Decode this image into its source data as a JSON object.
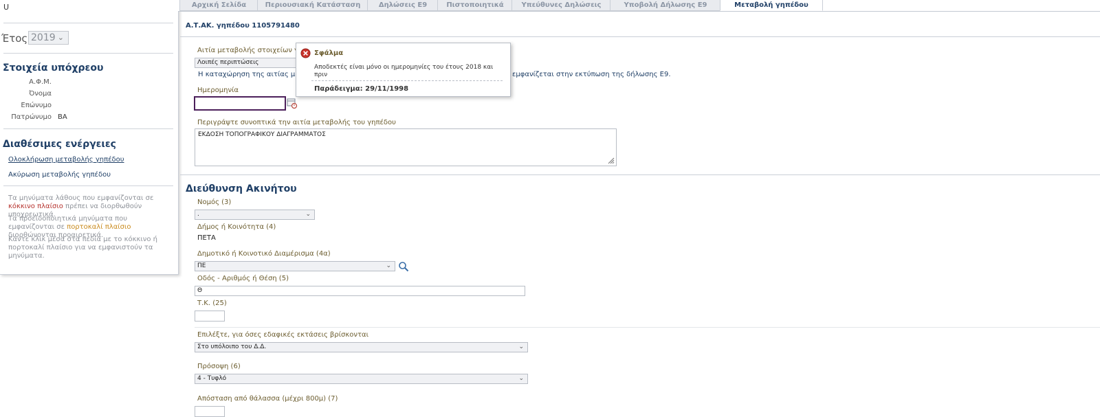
{
  "sidebar": {
    "top_text": "U",
    "year_label": "Έτος",
    "year_value": "2019",
    "taxpayer_heading": "Στοιχεία υπόχρεου",
    "fields": [
      {
        "label": "Α.Φ.Μ.",
        "value": ""
      },
      {
        "label": "Όνομα",
        "value": ""
      },
      {
        "label": "Επώνυμο",
        "value": ""
      },
      {
        "label": "Πατρώνυμο",
        "value": "ΒΑ"
      }
    ],
    "actions_heading": "Διαθέσιμες ενέργειες",
    "actions": [
      "Ολοκλήρωση μεταβολής γηπέδου",
      "Ακύρωση μεταβολής γηπέδου"
    ],
    "help": {
      "p1_a": "Τα μηνύματα λάθους που εμφανίζονται σε ",
      "p1_red": "κόκκινο πλαίσιο",
      "p1_b": " πρέπει να διορθωθούν υποχρεωτικά.",
      "p2_a": "Τα προειδοποιητικά μηνύματα που εμφανίζονται σε ",
      "p2_orange": "πορτοκαλί πλαίσιο",
      "p2_b": " διορθώνονται προαιρετικά.",
      "p3": "Κάντε κλικ μέσα στα πεδία με το κόκκινο ή πορτοκαλί πλαίσιο για να εμφανιστούν τα μηνύματα."
    }
  },
  "tabs": [
    {
      "label": "Αρχική Σελίδα",
      "active": false
    },
    {
      "label": "Περιουσιακή Κατάσταση",
      "active": false
    },
    {
      "label": "Δηλώσεις Ε9",
      "active": false
    },
    {
      "label": "Πιστοποιητικά",
      "active": false
    },
    {
      "label": "Υπεύθυνες Δηλώσεις",
      "active": false
    },
    {
      "label": "Υποβολή Δήλωσης Ε9",
      "active": false
    },
    {
      "label": "Μεταβολή γηπέδου",
      "active": true
    }
  ],
  "main": {
    "title": "Α.Τ.ΑΚ. γηπέδου 1105791480",
    "cause_label": "Αιτία μεταβολής στοιχείων γηπ",
    "cause_value": "Λοιπές περιπτώσεις",
    "cause_note_left": "Η καταχώρηση της αιτίας μετα",
    "cause_note_right": "εμφανίζεται στην εκτύπωση της δήλωσης Ε9.",
    "date_label": "Ημερομηνία",
    "date_value": "",
    "description_label": "Περιγράψτε συνοπτικά την αιτία μεταβολής του γηπέδου",
    "description_value": "ΕΚΔΟΣΗ ΤΟΠΟΓΡΑΦΙΚΟΥ ΔΙΑΓΡΑΜΜΑΤΟΣ",
    "address_heading": "Διεύθυνση Ακινήτου",
    "prefecture_label": "Νομός (3)",
    "prefecture_value": ".",
    "municipality_label": "Δήμος ή Κοινότητα (4)",
    "municipality_value": "ΠΕΤΑ",
    "district_label": "Δημοτικό ή Κοινοτικό Διαμέρισμα (4α)",
    "district_value": "ΠΕ",
    "street_label": "Οδός - Αριθμός ή Θέση (5)",
    "street_value": "Θ",
    "postal_label": "Τ.Κ. (25)",
    "postal_value": "",
    "area_label": "Επιλέξτε, για όσες εδαφικές εκτάσεις βρίσκονται",
    "area_value": "Στο υπόλοιπο του Δ.Δ.",
    "frontage_label": "Πρόσοψη (6)",
    "frontage_value": "4 - Τυφλό",
    "sea_label": "Απόσταση από θάλασσα (μέχρι 800μ) (7)"
  },
  "error_popup": {
    "title": "Σφάλμα",
    "message": "Αποδεκτές είναι μόνο οι ημερομηνίες του έτους 2018 και πριν",
    "example": "Παράδειγμα: 29/11/1998"
  },
  "colors": {
    "heading": "#1f3f66",
    "label": "#6b5c2e",
    "error_border": "#4b1f5a",
    "error_icon": "#c9342c"
  }
}
